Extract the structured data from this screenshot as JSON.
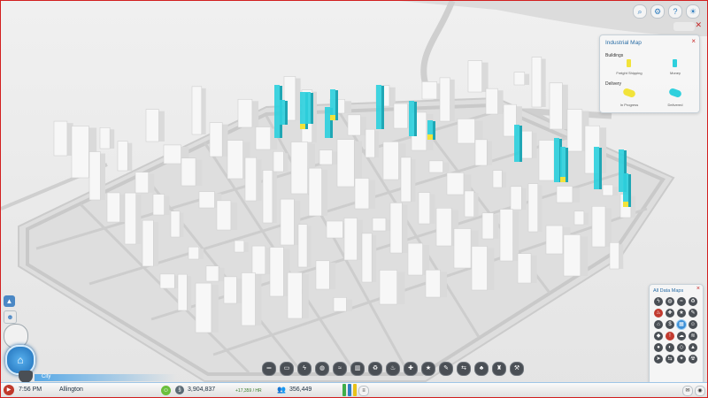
{
  "industrial_map": {
    "title": "Industrial Map",
    "buildings_label": "Buildings",
    "buildings_legend": [
      {
        "label": "Freight Shipping",
        "color": "#f2e33a"
      },
      {
        "label": "Money",
        "color": "#2fd0dd"
      }
    ],
    "deliveries_label": "Delivery",
    "deliveries_legend": [
      {
        "label": "In Progress",
        "color": "#f2e33a"
      },
      {
        "label": "Delivered",
        "color": "#2fd0dd"
      }
    ],
    "close": "×"
  },
  "data_maps": {
    "title": "All Data Maps",
    "close": "×",
    "icons": [
      "power-icon",
      "water-icon",
      "sewage-icon",
      "garbage-icon",
      "fire-icon",
      "health-icon",
      "police-icon",
      "education-icon",
      "residential-icon",
      "commercial-icon",
      "industrial-icon",
      "happiness-icon",
      "land-value-icon",
      "crime-icon",
      "pollution-icon",
      "wind-icon",
      "coal-icon",
      "oil-icon",
      "ore-icon",
      "raw-icon",
      "traffic-icon",
      "transit-icon",
      "tourism-icon",
      "radiation-icon"
    ],
    "selected_index": 10
  },
  "toolbar_icons": [
    "roads-icon",
    "zones-icon",
    "power-icon",
    "water-icon",
    "sewage-icon",
    "government-icon",
    "garbage-icon",
    "fire-icon",
    "health-icon",
    "police-icon",
    "education-icon",
    "transit-icon",
    "parks-icon",
    "landmark-icon",
    "specialization-icon"
  ],
  "city_label": "City",
  "status": {
    "time": "7:56 PM",
    "city_name": "Allington",
    "funds": "3,904,837",
    "income": "+17,359 / HR",
    "population": "356,449"
  },
  "colors": {
    "accent": "#3c8fd6",
    "freight": "#f2e33a",
    "money": "#2fd0dd"
  }
}
